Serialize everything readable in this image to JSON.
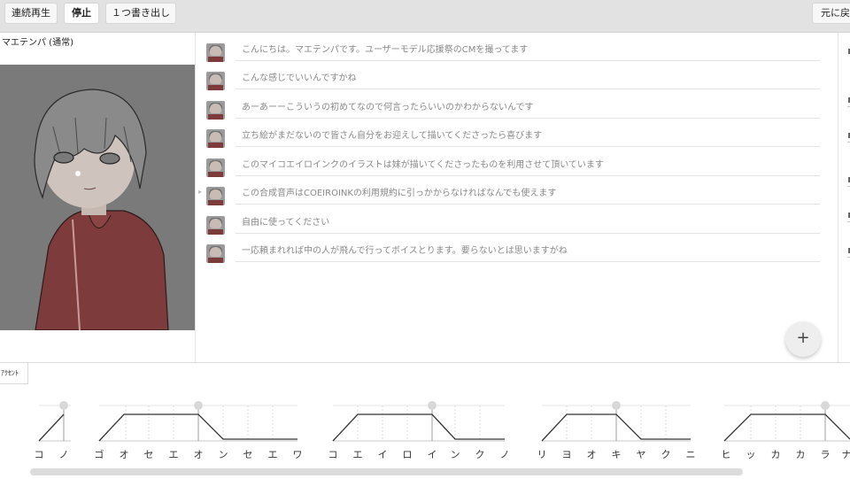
{
  "toolbar": {
    "buttons": [
      {
        "label": "連続再生"
      },
      {
        "label": "停止"
      },
      {
        "label": "１つ書き出し"
      }
    ],
    "right_button": "元に戻す"
  },
  "character": {
    "name": "マエテンパ (通常)"
  },
  "talk_items": [
    "こんにちは。マエテンパです。ユーザーモデル応援祭のCMを撮ってます",
    "こんな感じでいいんですかね",
    "あーあーーこういうの初めてなので何言ったらいいのかわからないんです",
    "立ち絵がまだないので皆さん自分をお迎えして描いてくださったら喜びます",
    "このマイコエイロインクのイラストは妹が描いてくださったものを利用させて頂いています",
    "この合成音声はCOEIROINKの利用規約に引っかからなければなんでも使えます",
    "自由に使ってください",
    "一応頼まれれば中の人が飛んで行ってボイスとります。要らないとは思いますがね"
  ],
  "add_button": "+",
  "accent": {
    "tab_label": "ｱｸｾﾝﾄ",
    "moras": [
      "コ",
      "ノ",
      "ゴ",
      "オ",
      "セ",
      "エ",
      "オ",
      "ン",
      "セ",
      "エ",
      "ワ",
      "コ",
      "エ",
      "イ",
      "ロ",
      "イ",
      "ン",
      "ク",
      "ノ",
      "リ",
      "ヨ",
      "オ",
      "キ",
      "ヤ",
      "ク",
      "ニ",
      "ヒ",
      "ッ",
      "カ",
      "カ",
      "ラ",
      "ナ"
    ]
  },
  "colors": {
    "toolbar_bg": "#e2e2e2",
    "portrait_bg": "#7a7a7a",
    "robe": "#7d3b3b"
  }
}
